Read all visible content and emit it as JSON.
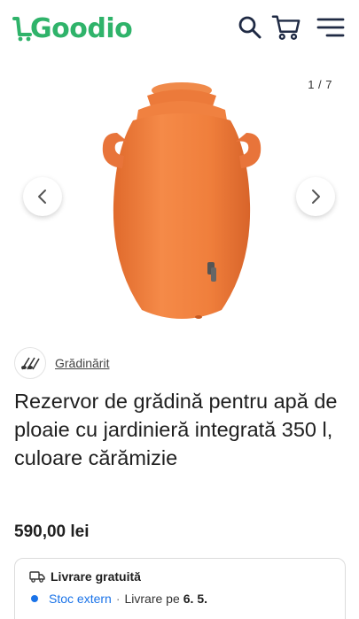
{
  "header": {
    "logo_text": "Goodio",
    "brand_color": "#2fb36a",
    "icons": [
      "search-icon",
      "cart-icon",
      "menu-icon"
    ]
  },
  "gallery": {
    "counter": "1 / 7",
    "prev_icon": "chevron-left-icon",
    "next_icon": "chevron-right-icon",
    "product_color": "#f07f3c"
  },
  "category": {
    "label": "Grădinărit",
    "icon": "garden-tools-icon"
  },
  "product": {
    "title": "Rezervor de grădină pentru apă de ploaie cu jardinieră integrată 350 l, culoare cărămizie",
    "price": "590,00 lei"
  },
  "delivery": {
    "free_label": "Livrare gratuită",
    "stock_label": "Stoc extern",
    "separator": "·",
    "delivery_text": "Livrare pe",
    "delivery_date": "6. 5.",
    "accent_color": "#1a73e8"
  }
}
